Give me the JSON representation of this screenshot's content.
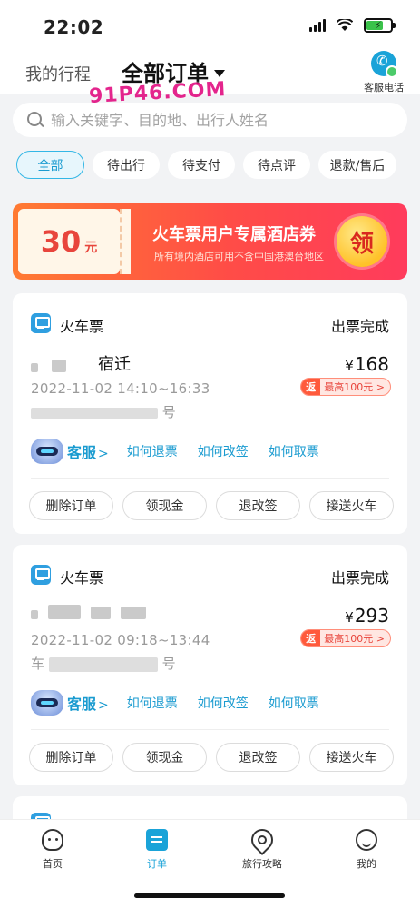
{
  "status_bar": {
    "time": "22:02",
    "battery_bolt": "⚡"
  },
  "watermark": "91P46.COM",
  "header": {
    "tab_trips": "我的行程",
    "tab_orders": "全部订单",
    "cs_phone_label": "客服电话",
    "cs_phone_glyph": "✆"
  },
  "search": {
    "placeholder": "输入关键字、目的地、出行人姓名"
  },
  "filters": [
    {
      "label": "全部",
      "active": true
    },
    {
      "label": "待出行"
    },
    {
      "label": "待支付"
    },
    {
      "label": "待点评"
    },
    {
      "label": "退款/售后"
    }
  ],
  "coupon": {
    "amount": "30",
    "unit": "元",
    "title": "火车票用户专属酒店券",
    "subtitle": "所有境内酒店可用不含中国港澳台地区",
    "button": "领"
  },
  "orders": [
    {
      "type": "火车票",
      "status": "出票完成",
      "route": "宿迁",
      "datetime": "2022-11-02 14:10~16:33",
      "seat_suffix": "号",
      "price_symbol": "¥",
      "price": "168",
      "rebate_tag": "返",
      "rebate_text": "最高100元 >",
      "cs_label": "客服",
      "cs_chev": ">",
      "help_links": [
        "如何退票",
        "如何改签",
        "如何取票"
      ],
      "actions": [
        "删除订单",
        "领现金",
        "退改签",
        "接送火车"
      ]
    },
    {
      "type": "火车票",
      "status": "出票完成",
      "route": "",
      "datetime": "2022-11-02 09:18~13:44",
      "seat_prefix": "车",
      "seat_suffix": "号",
      "price_symbol": "¥",
      "price": "293",
      "rebate_tag": "返",
      "rebate_text": "最高100元 >",
      "cs_label": "客服",
      "cs_chev": ">",
      "help_links": [
        "如何退票",
        "如何改签",
        "如何取票"
      ],
      "actions": [
        "删除订单",
        "领现金",
        "退改签",
        "接送火车"
      ]
    }
  ],
  "tabbar": [
    {
      "label": "首页",
      "icon": "home-icon"
    },
    {
      "label": "订单",
      "icon": "order-icon",
      "active": true
    },
    {
      "label": "旅行攻略",
      "icon": "location-pin-icon"
    },
    {
      "label": "我的",
      "icon": "smiley-icon"
    }
  ],
  "colors": {
    "accent": "#1aa3d8",
    "coupon_red": "#ff4c47",
    "rebate_red": "#ff5a3c"
  }
}
